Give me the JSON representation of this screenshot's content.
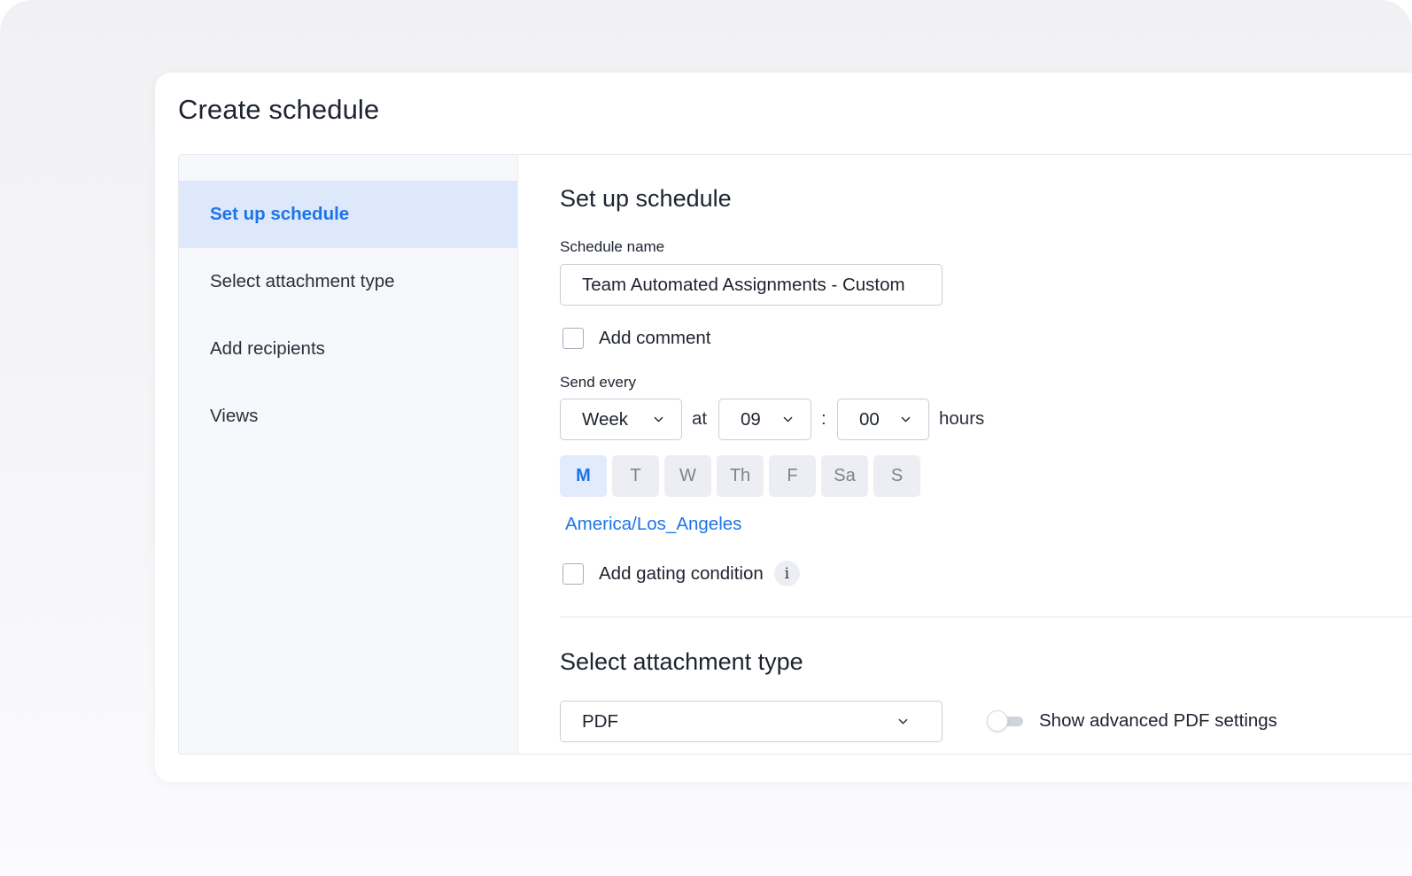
{
  "dialog": {
    "title": "Create schedule"
  },
  "sidebar": {
    "items": [
      {
        "label": "Set up schedule",
        "active": true
      },
      {
        "label": "Select attachment type",
        "active": false
      },
      {
        "label": "Add recipients",
        "active": false
      },
      {
        "label": "Views",
        "active": false
      }
    ]
  },
  "schedule": {
    "section_title": "Set up schedule",
    "name_label": "Schedule name",
    "name_value": "Team Automated Assignments - Custom",
    "add_comment_label": "Add comment",
    "add_comment_checked": false,
    "send_every_label": "Send every",
    "frequency": "Week",
    "at_label": "at",
    "hour": "09",
    "colon": ":",
    "minute": "00",
    "hours_label": "hours",
    "days": [
      {
        "label": "M",
        "selected": true
      },
      {
        "label": "T",
        "selected": false
      },
      {
        "label": "W",
        "selected": false
      },
      {
        "label": "Th",
        "selected": false
      },
      {
        "label": "F",
        "selected": false
      },
      {
        "label": "Sa",
        "selected": false
      },
      {
        "label": "S",
        "selected": false
      }
    ],
    "timezone": "America/Los_Angeles",
    "gating_label": "Add gating condition",
    "gating_checked": false,
    "info_icon_glyph": "i"
  },
  "attachment": {
    "section_title": "Select attachment type",
    "type_value": "PDF",
    "advanced_toggle_label": "Show advanced PDF settings",
    "advanced_toggle_on": false
  },
  "colors": {
    "accent": "#1d74e8",
    "active_nav_bg": "#dde8fb",
    "sidebar_bg": "#f7f8fc",
    "text": "#1d232f"
  }
}
